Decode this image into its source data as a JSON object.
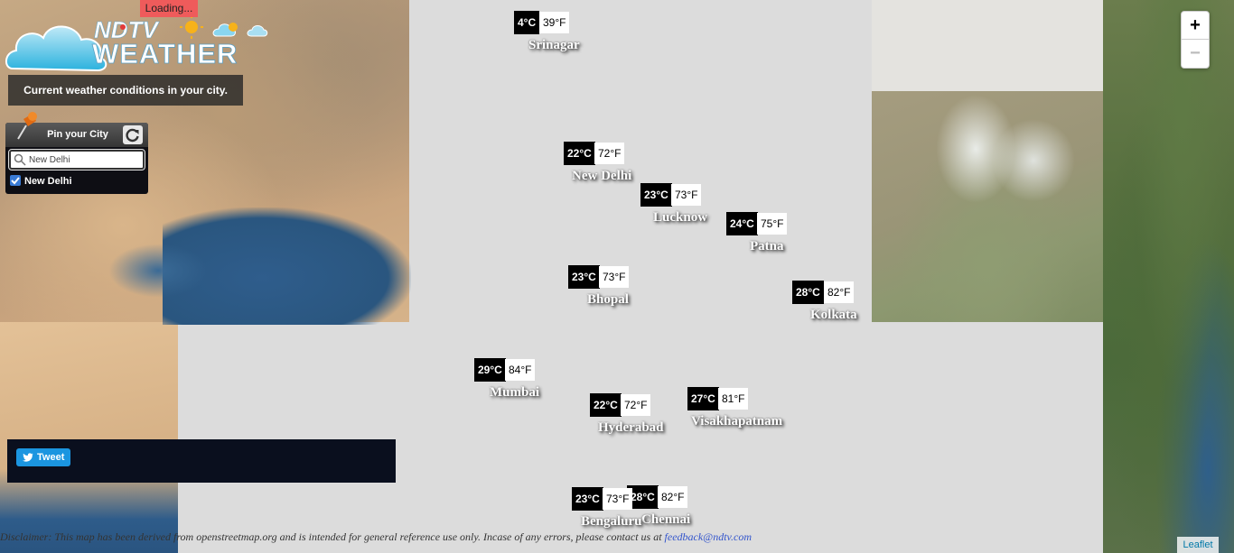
{
  "loading": "Loading...",
  "logo": {
    "text_ndtv": "NDTV",
    "text_weather": "WEATHER"
  },
  "tagline": "Current weather conditions in your city.",
  "pin_panel": {
    "title": "Pin your City",
    "search_value": "New Delhi",
    "checked_city": "New Delhi"
  },
  "cities": [
    {
      "name": "Srinagar",
      "c": "4°C",
      "f": "39°F"
    },
    {
      "name": "New Delhi",
      "c": "22°C",
      "f": "72°F"
    },
    {
      "name": "Lucknow",
      "c": "23°C",
      "f": "73°F"
    },
    {
      "name": "Patna",
      "c": "24°C",
      "f": "75°F"
    },
    {
      "name": "Bhopal",
      "c": "23°C",
      "f": "73°F"
    },
    {
      "name": "Kolkata",
      "c": "28°C",
      "f": "82°F"
    },
    {
      "name": "Mumbai",
      "c": "29°C",
      "f": "84°F"
    },
    {
      "name": "Hyderabad",
      "c": "22°C",
      "f": "72°F"
    },
    {
      "name": "Visakhapatnam",
      "c": "27°C",
      "f": "81°F"
    },
    {
      "name": "Bengaluru",
      "c": "23°C",
      "f": "73°F"
    },
    {
      "name": "Chennai",
      "c": "28°C",
      "f": "82°F"
    }
  ],
  "social": {
    "tweet_label": "Tweet"
  },
  "zoom": {
    "in": "+",
    "out": "−"
  },
  "disclaimer": {
    "text": "Disclaimer: This map has been derived from openstreetmap.org and is intended for general reference use only. Incase of any errors, please contact us at ",
    "email": "feedback@ndtv.com"
  },
  "attribution": "Leaflet",
  "icons": {
    "logo": "cloud-sun-icon",
    "pin": "pushpin-icon",
    "refresh": "refresh-icon",
    "search": "search-icon",
    "tweet": "twitter-bird-icon"
  },
  "colors": {
    "loading_bg": "#ef5b5b",
    "tweet_bg": "#1b95e0",
    "temp_c_bg": "#000000",
    "temp_f_bg": "#ffffff",
    "link": "#3355cc"
  }
}
